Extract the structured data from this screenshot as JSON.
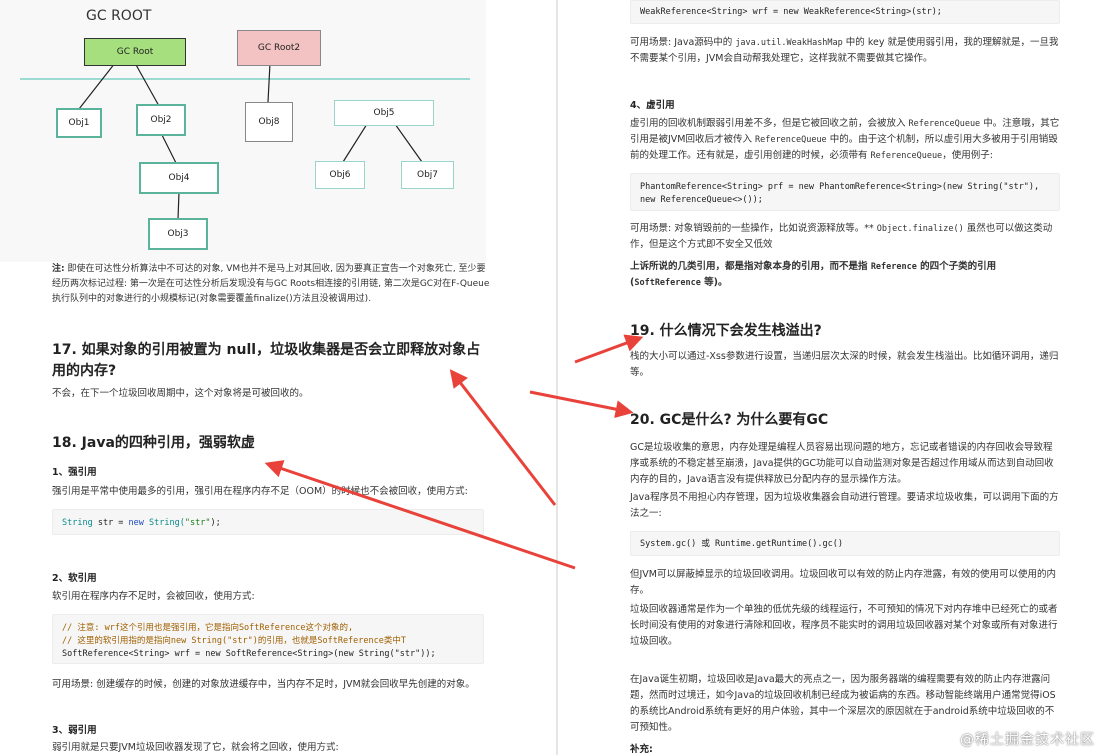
{
  "diagram": {
    "title": "GC ROOT",
    "root1": "GC Root",
    "root2": "GC Root2",
    "obj1": "Obj1",
    "obj2": "Obj2",
    "obj3": "Obj3",
    "obj4": "Obj4",
    "obj5": "Obj5",
    "obj6": "Obj6",
    "obj7": "Obj7",
    "obj8": "Obj8"
  },
  "left": {
    "note_label": "注:",
    "note_text": " 即使在可达性分析算法中不可达的对象, VM也并不是马上对其回收, 因为要真正宣告一个对象死亡, 至少要经历两次标记过程: 第一次是在可达性分析后发现没有与GC Roots相连接的引用链, 第二次是GC对在F-Queue执行队列中的对象进行的小规模标记(对象需要覆盖finalize()方法且没被调用过).",
    "q17_title": "17. 如果对象的引用被置为 null，垃圾收集器是否会立即释放对象占用的内存?",
    "q17_answer": "不会，在下一个垃圾回收周期中，这个对象将是可被回收的。",
    "q18_title": "18. Java的四种引用，强弱软虚",
    "strong_heading": "1、强引用",
    "strong_text": "强引用是平常中使用最多的引用，强引用在程序内存不足（OOM）的时候也不会被回收，使用方式:",
    "strong_code": {
      "type": "String",
      "var": " str = ",
      "new": "new",
      "type2": " String(",
      "str": "\"str\"",
      "end": ");"
    },
    "soft_heading": "2、软引用",
    "soft_text": "软引用在程序内存不足时，会被回收，使用方式:",
    "soft_code_c1": "// 注意: wrf这个引用也是强引用，它是指向SoftReference这个对象的,",
    "soft_code_c2": "// 这里的软引用指的是指向new String(\"str\")的引用，也就是SoftReference类中T",
    "soft_code_line": "SoftReference<String> wrf = new SoftReference<String>(new String(\"str\"));",
    "soft_usage": "可用场景:  创建缓存的时候，创建的对象放进缓存中，当内存不足时，JVM就会回收早先创建的对象。",
    "weak_heading": "3、弱引用",
    "weak_text": "弱引用就是只要JVM垃圾回收器发现了它，就会将之回收，使用方式:"
  },
  "right": {
    "weak_code": "WeakReference<String> wrf = new WeakReference<String>(str);",
    "weak_usage_a": "可用场景:  Java源码中的 ",
    "weak_usage_code": "java.util.WeakHashMap",
    "weak_usage_b": " 中的 key 就是使用弱引用，我的理解就是，一旦我不需要某个引用，JVM会自动帮我处理它，这样我就不需要做其它操作。",
    "phantom_heading": "4、虚引用",
    "phantom_text_a": "虚引用的回收机制跟弱引用差不多，但是它被回收之前，会被放入 ",
    "phantom_code_a": "ReferenceQueue",
    "phantom_text_b": " 中。注意哦，其它引用是被JVM回收后才被传入 ",
    "phantom_code_b": "ReferenceQueue",
    "phantom_text_c": " 中的。由于这个机制，所以虚引用大多被用于引用销毁前的处理工作。还有就是，虚引用创建的时候，必须带有 ",
    "phantom_code_c": "ReferenceQueue",
    "phantom_text_d": "，使用例子:",
    "phantom_code_1": "PhantomReference<String> prf = new PhantomReference<String>(new String(\"str\"),",
    "phantom_code_2": "new ReferenceQueue<>());",
    "phantom_usage_a": "可用场景:  对象销毁前的一些操作，比如说资源释放等。** ",
    "phantom_usage_code": "Object.finalize()",
    "phantom_usage_b": " 虽然也可以做这类动作，但是这个方式即不安全又低效",
    "summary_a": "上诉所说的几类引用，都是指对象本身的引用，而不是指 ",
    "summary_code_a": "Reference",
    "summary_b": " 的四个子类的引用 (",
    "summary_code_b": "SoftReference",
    "summary_c": " 等)。",
    "q19_title": "19. 什么情况下会发生栈溢出?",
    "q19_text": "栈的大小可以通过-Xss参数进行设置，当递归层次太深的时候，就会发生栈溢出。比如循环调用，递归等。",
    "q20_title": "20. GC是什么? 为什么要有GC",
    "q20_p1": "GC是垃圾收集的意思，内存处理是编程人员容易出现问题的地方，忘记或者错误的内存回收会导致程序或系统的不稳定甚至崩溃，Java提供的GC功能可以自动监测对象是否超过作用域从而达到自动回收内存的目的，Java语言没有提供释放已分配内存的显示操作方法。",
    "q20_p2": "Java程序员不用担心内存管理，因为垃圾收集器会自动进行管理。要请求垃圾收集，可以调用下面的方法之一:",
    "q20_code_a": "System.gc()",
    "q20_code_or": " 或 ",
    "q20_code_b": "Runtime.getRuntime().gc()",
    "q20_p3": "但JVM可以屏蔽掉显示的垃圾回收调用。垃圾回收可以有效的防止内存泄露，有效的使用可以使用的内存。",
    "q20_p4": "垃圾回收器通常是作为一个单独的低优先级的线程运行，不可预知的情况下对内存堆中已经死亡的或者长时间没有使用的对象进行清除和回收，程序员不能实时的调用垃圾回收器对某个对象或所有对象进行垃圾回收。",
    "q20_p5": "在Java诞生初期，垃圾回收是Java最大的亮点之一，因为服务器端的编程需要有效的防止内存泄露问题，然而时过境迁，如今Java的垃圾回收机制已经成为被诟病的东西。移动智能终端用户通常觉得iOS的系统比Android系统有更好的用户体验，其中一个深层次的原因就在于android系统中垃圾回收的不可预知性。",
    "supplement": "补充:"
  },
  "watermark": "@稀土掘金技术社区",
  "colors": {
    "arrow": "#e8423a",
    "gc_root_fill": "#a6e07e",
    "gc_root2_fill": "#f3c2c2",
    "node_border": "#5bb39b",
    "line": "#7fd1c6"
  }
}
